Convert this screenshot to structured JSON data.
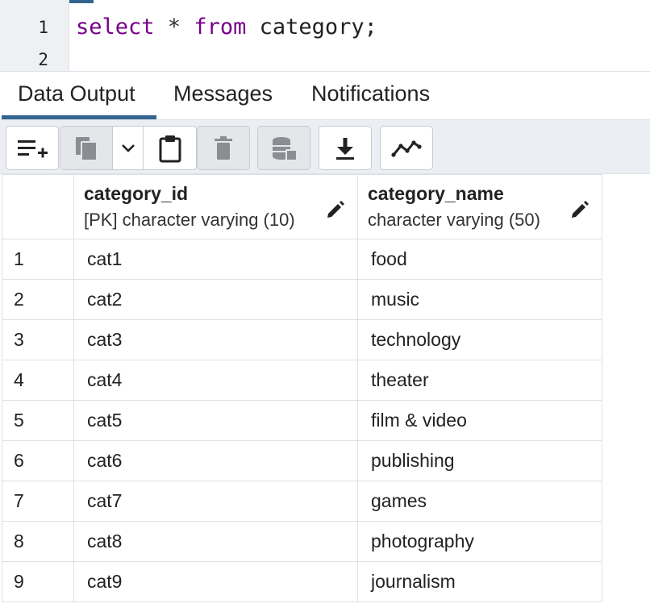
{
  "editor": {
    "lines": [
      {
        "number": "1",
        "kw1": "select",
        "mid": " * ",
        "kw2": "from",
        "rest": " category;"
      },
      {
        "number": "2"
      }
    ]
  },
  "tabs": [
    {
      "label": "Data Output",
      "active": true
    },
    {
      "label": "Messages",
      "active": false
    },
    {
      "label": "Notifications",
      "active": false
    }
  ],
  "toolbar": {
    "buttons": [
      {
        "name": "add-row",
        "icon": "add-row-icon"
      },
      {
        "name": "copy",
        "icon": "copy-icon"
      },
      {
        "name": "copy-options",
        "icon": "chevron-down-icon"
      },
      {
        "name": "paste",
        "icon": "clipboard-icon"
      },
      {
        "name": "delete",
        "icon": "trash-icon"
      },
      {
        "name": "save-data",
        "icon": "database-save-icon"
      },
      {
        "name": "download",
        "icon": "download-icon"
      },
      {
        "name": "graph",
        "icon": "line-chart-icon"
      }
    ]
  },
  "grid": {
    "columns": [
      {
        "name": "category_id",
        "type": "[PK] character varying (10)"
      },
      {
        "name": "category_name",
        "type": "character varying (50)"
      }
    ],
    "rows": [
      {
        "num": "1",
        "category_id": "cat1",
        "category_name": "food"
      },
      {
        "num": "2",
        "category_id": "cat2",
        "category_name": "music"
      },
      {
        "num": "3",
        "category_id": "cat3",
        "category_name": "technology"
      },
      {
        "num": "4",
        "category_id": "cat4",
        "category_name": "theater"
      },
      {
        "num": "5",
        "category_id": "cat5",
        "category_name": "film & video"
      },
      {
        "num": "6",
        "category_id": "cat6",
        "category_name": "publishing"
      },
      {
        "num": "7",
        "category_id": "cat7",
        "category_name": "games"
      },
      {
        "num": "8",
        "category_id": "cat8",
        "category_name": "photography"
      },
      {
        "num": "9",
        "category_id": "cat9",
        "category_name": "journalism"
      }
    ]
  },
  "colors": {
    "accent": "#326690",
    "keyword": "#770088",
    "toolbar_bg": "#ebeef3",
    "gutter_bg": "#eef0f3"
  }
}
